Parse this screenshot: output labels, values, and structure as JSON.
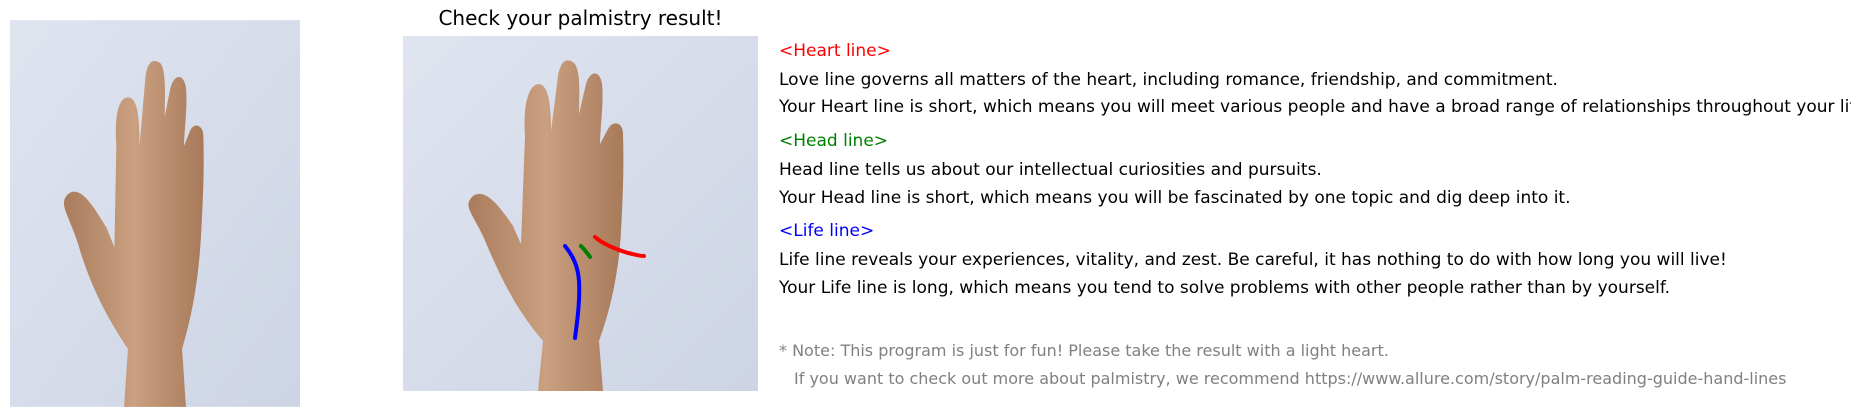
{
  "title": "Check your palmistry result!",
  "images": {
    "original": "hand-photo",
    "result": "hand-photo-with-palm-lines"
  },
  "colors": {
    "background": "#ffffff",
    "heart": "#ff0000",
    "head": "#008000",
    "life": "#0000ff",
    "note": "#808080",
    "wall": "#d6dcea",
    "skin": "#c49a78"
  },
  "lines": [
    {
      "header": "<Heart line>",
      "description": "Love line governs all matters of the heart, including romance, friendship, and commitment.",
      "result": "Your Heart line is short, which means you will meet various people and have a broad range of relationships throughout your life."
    },
    {
      "header": "<Head line>",
      "description": "Head line tells us about our intellectual curiosities and pursuits.",
      "result": "Your Head line is short, which means you will be fascinated by one topic and dig deep into it."
    },
    {
      "header": "<Life line>",
      "description": "Life line reveals your experiences, vitality, and zest. Be careful, it has nothing to do with how long you will live!",
      "result": "Your Life line is long, which means you tend to solve problems with other people rather than by yourself."
    }
  ],
  "note": {
    "line1": "* Note: This program is just for fun! Please take the result with a light heart.",
    "line2": "If you want to check out more about palmistry, we recommend https://www.allure.com/story/palm-reading-guide-hand-lines"
  }
}
